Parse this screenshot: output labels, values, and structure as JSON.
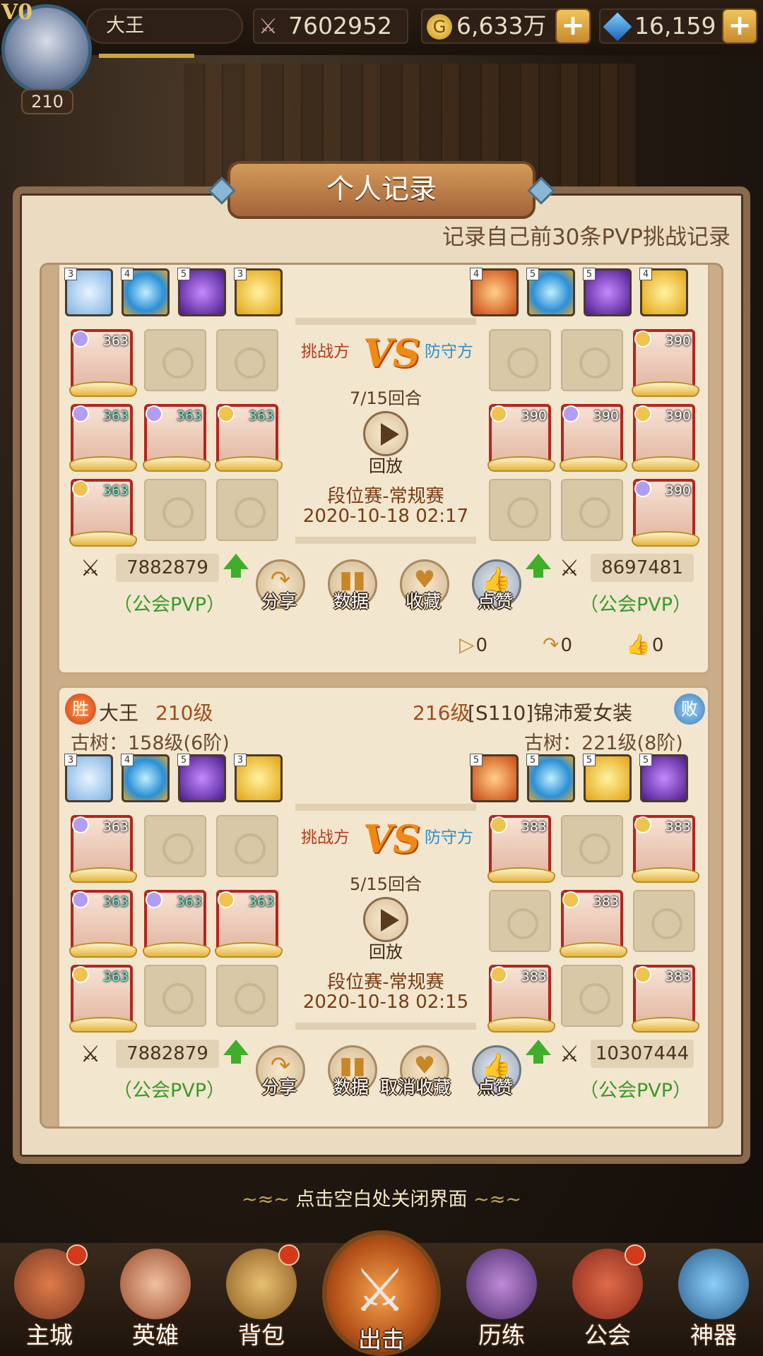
{
  "topbar": {
    "vip": "V0",
    "player_level": "210",
    "player_name": "大王",
    "power": "7602952",
    "gold": "6,633万",
    "gems": "16,159",
    "plus": "+"
  },
  "panel": {
    "title": "个人记录",
    "subtitle": "记录自己前30条PVP挑战记录"
  },
  "records": [
    {
      "left_artifacts": [
        "3",
        "4",
        "5",
        "3"
      ],
      "right_artifacts": [
        "4",
        "5",
        "5",
        "4"
      ],
      "left_heroes": [
        [
          "363",
          "",
          ""
        ],
        [
          "363",
          "363",
          "363"
        ],
        [
          "363",
          "",
          ""
        ]
      ],
      "right_heroes": [
        [
          "",
          "",
          "390"
        ],
        [
          "390",
          "390",
          "390"
        ],
        [
          "",
          "",
          "390"
        ]
      ],
      "attacker_label": "挑战方",
      "defender_label": "防守方",
      "rounds": "7/15回合",
      "replay_label": "回放",
      "mode": "段位赛-常规赛",
      "date": "2020-10-18 02:17",
      "left_power": "7882879",
      "right_power": "8697481",
      "left_tag": "（公会PVP）",
      "right_tag": "（公会PVP）",
      "actions": [
        "分享",
        "数据",
        "收藏",
        "点赞"
      ],
      "replays": "0",
      "shares": "0",
      "likes": "0"
    },
    {
      "left_result": "胜",
      "right_result": "败",
      "left_name": "大王",
      "left_level": "210级",
      "right_level": "216级",
      "right_name": "[S110]锦沛爱女装",
      "left_tree": "古树：158级(6阶)",
      "right_tree": "古树：221级(8阶)",
      "left_artifacts": [
        "3",
        "4",
        "5",
        "3"
      ],
      "right_artifacts": [
        "5",
        "5",
        "5",
        "5"
      ],
      "left_heroes": [
        [
          "363",
          "",
          ""
        ],
        [
          "363",
          "363",
          "363"
        ],
        [
          "363",
          "",
          ""
        ]
      ],
      "right_heroes": [
        [
          "383",
          "",
          "383"
        ],
        [
          "",
          "383",
          ""
        ],
        [
          "383",
          "",
          "383"
        ]
      ],
      "attacker_label": "挑战方",
      "defender_label": "防守方",
      "rounds": "5/15回合",
      "replay_label": "回放",
      "mode": "段位赛-常规赛",
      "date": "2020-10-18 02:15",
      "left_power": "7882879",
      "right_power": "10307444",
      "left_tag": "（公会PVP）",
      "right_tag": "（公会PVP）",
      "actions": [
        "分享",
        "数据",
        "取消收藏",
        "点赞"
      ]
    }
  ],
  "close_hint": "点击空白处关闭界面",
  "nav": [
    "主城",
    "英雄",
    "背包",
    "出击",
    "历练",
    "公会",
    "神器"
  ],
  "icons": {
    "swords": "⚔",
    "share": "↷",
    "data": "▮",
    "heart": "♥",
    "thumb": "👍",
    "play": "▷"
  },
  "colors": {
    "panel": "#ebdcc1",
    "hero_frame": "#b3261e",
    "pvp_green": "#3a9a2a",
    "attacker_red": "#b33a1a",
    "defender_blue": "#2e8ec8"
  }
}
